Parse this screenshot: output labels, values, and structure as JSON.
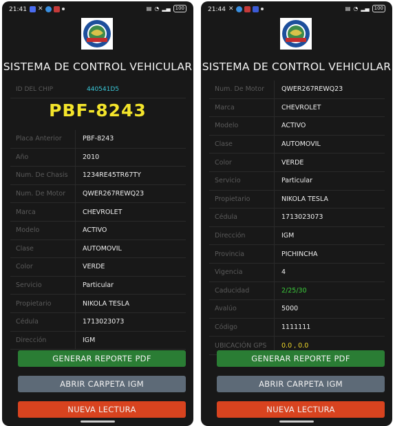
{
  "colors": {
    "background": "#181818",
    "plate": "#f4e52b",
    "chip_value": "#39c6d6",
    "generate_button": "#2a7d34",
    "folder_button": "#5d6a77",
    "new_read_button": "#d8431f"
  },
  "left": {
    "status": {
      "time": "21:41",
      "battery": "100"
    },
    "title": "SISTEMA DE CONTROL VEHICULAR",
    "chip": {
      "label": "ID DEL CHIP",
      "value": "440541D5"
    },
    "plate": "PBF-8243",
    "rows": [
      {
        "label": "Placa Anterior",
        "value": "PBF-8243"
      },
      {
        "label": "Año",
        "value": "2010"
      },
      {
        "label": "Num. De Chasis",
        "value": "1234RE45TR67TY"
      },
      {
        "label": "Num. De Motor",
        "value": "QWER267REWQ23"
      },
      {
        "label": "Marca",
        "value": "CHEVROLET"
      },
      {
        "label": "Modelo",
        "value": "ACTIVO"
      },
      {
        "label": "Clase",
        "value": "AUTOMOVIL"
      },
      {
        "label": "Color",
        "value": "VERDE"
      },
      {
        "label": "Servicio",
        "value": "Particular"
      },
      {
        "label": "Propietario",
        "value": "NIKOLA TESLA"
      },
      {
        "label": "Cédula",
        "value": "1713023073"
      },
      {
        "label": "Dirección",
        "value": "IGM"
      }
    ],
    "buttons": {
      "generate": "GENERAR REPORTE PDF",
      "open_folder": "ABRIR CARPETA IGM",
      "new_read": "NUEVA LECTURA"
    }
  },
  "right": {
    "status": {
      "time": "21:44",
      "battery": "100"
    },
    "title": "SISTEMA DE CONTROL VEHICULAR",
    "rows": [
      {
        "label": "Num. De Motor",
        "value": "QWER267REWQ23"
      },
      {
        "label": "Marca",
        "value": "CHEVROLET"
      },
      {
        "label": "Modelo",
        "value": "ACTIVO"
      },
      {
        "label": "Clase",
        "value": "AUTOMOVIL"
      },
      {
        "label": "Color",
        "value": "VERDE"
      },
      {
        "label": "Servicio",
        "value": "Particular"
      },
      {
        "label": "Propietario",
        "value": "NIKOLA TESLA"
      },
      {
        "label": "Cédula",
        "value": "1713023073"
      },
      {
        "label": "Dirección",
        "value": "IGM"
      },
      {
        "label": "Provincia",
        "value": "PICHINCHA"
      },
      {
        "label": "Vigencia",
        "value": "4"
      },
      {
        "label": "Caducidad",
        "value": "2/25/30"
      },
      {
        "label": "Avalúo",
        "value": "5000"
      },
      {
        "label": "Código",
        "value": "1111111"
      },
      {
        "label": "UBICACIÓN GPS",
        "value": "0.0 , 0.0"
      }
    ],
    "buttons": {
      "generate": "GENERAR REPORTE PDF",
      "open_folder": "ABRIR CARPETA IGM",
      "new_read": "NUEVA LECTURA"
    }
  }
}
